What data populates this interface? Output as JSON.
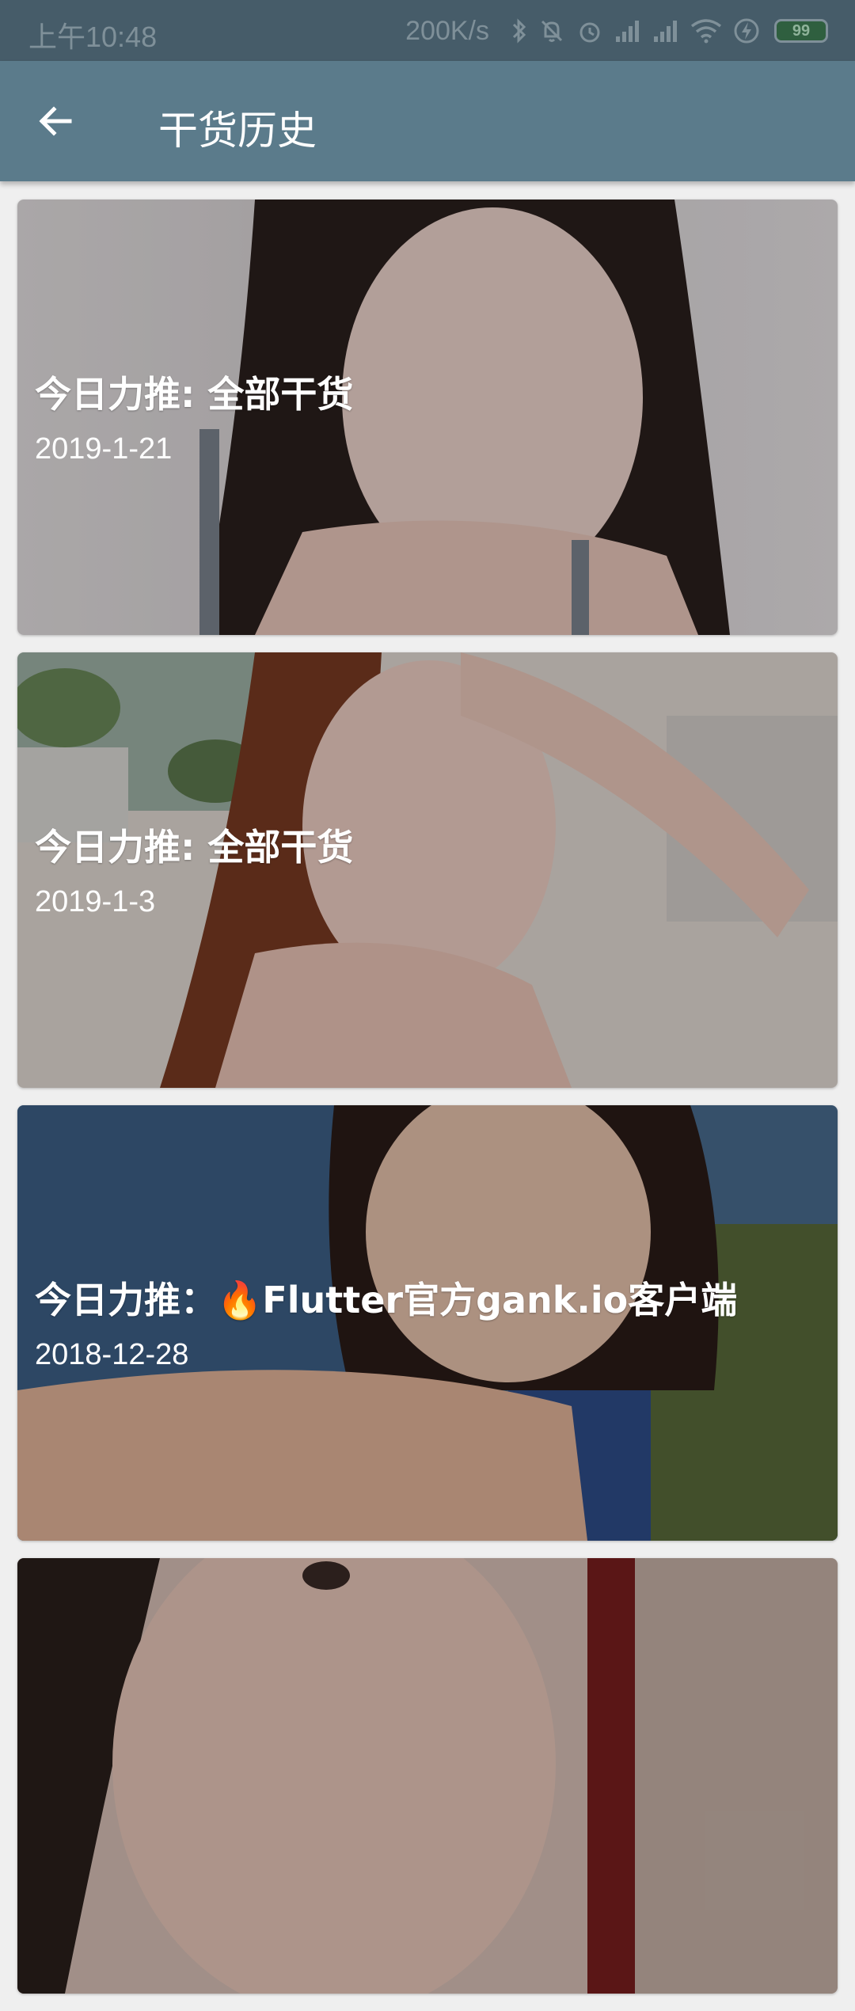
{
  "status_bar": {
    "time": "上午10:48",
    "network_speed": "200K/s",
    "battery_level": "99",
    "icons": [
      "bluetooth-icon",
      "mute-icon",
      "alarm-icon",
      "signal-icon",
      "signal-icon",
      "wifi-icon",
      "charging-icon",
      "battery-icon"
    ]
  },
  "app_bar": {
    "title": "干货历史",
    "back_icon": "arrow-left-icon",
    "color": "#5b7b8b"
  },
  "history": [
    {
      "title": "今日力推: 全部干货",
      "date": "2019-1-21"
    },
    {
      "title": "今日力推: 全部干货",
      "date": "2019-1-3"
    },
    {
      "title": "今日力推：🔥Flutter官方gank.io客户端",
      "date": "2018-12-28"
    },
    {
      "title": "",
      "date": ""
    }
  ]
}
